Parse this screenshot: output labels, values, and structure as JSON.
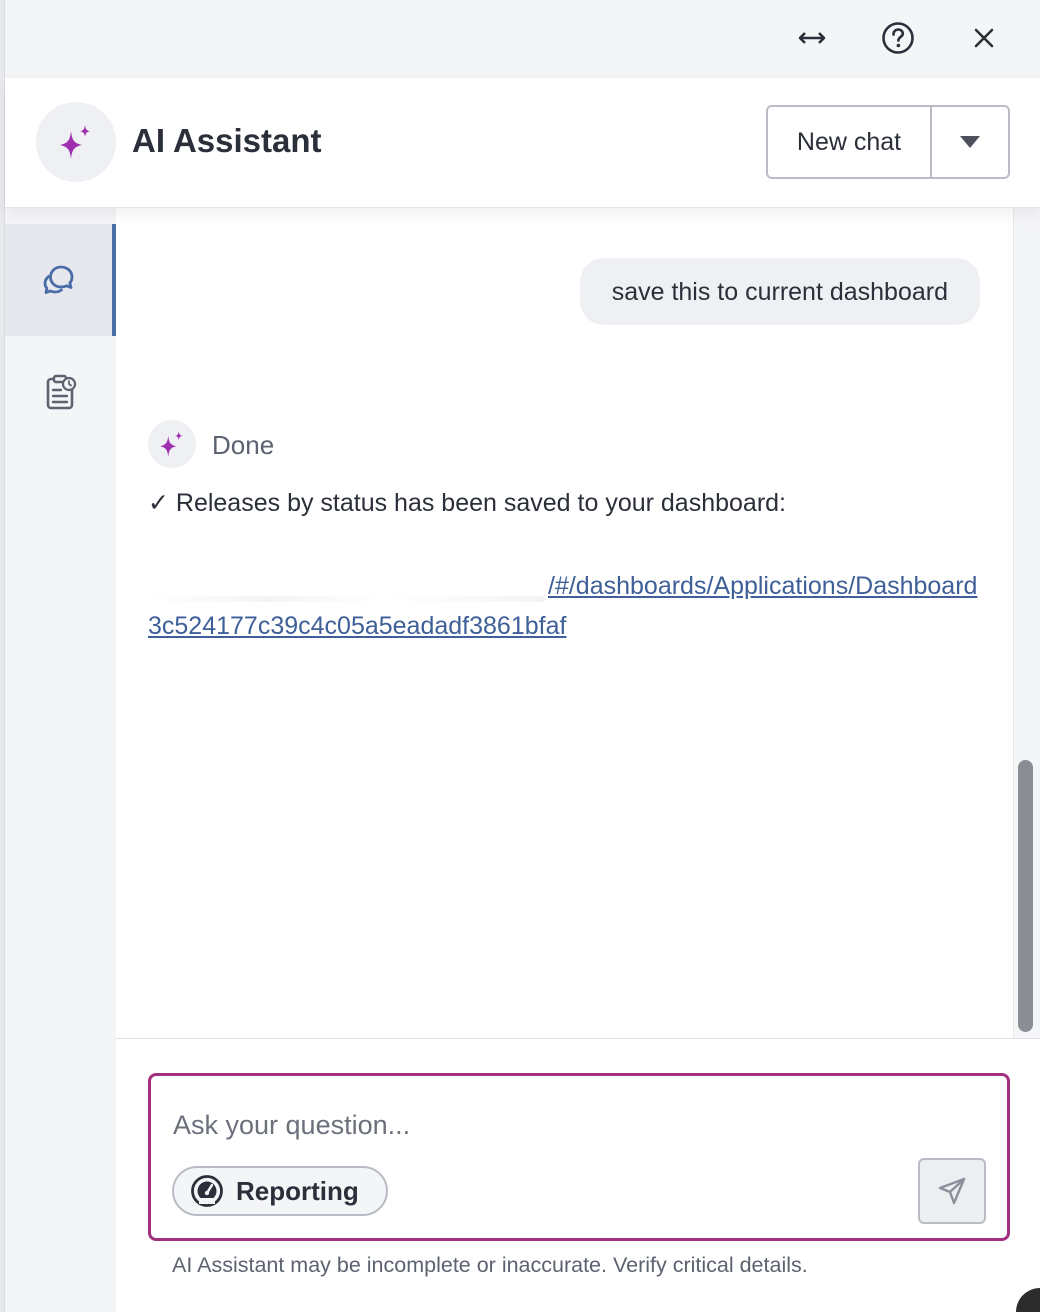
{
  "toolbar": {
    "expand_icon": "horizontal-arrows-icon",
    "help_icon": "help-circle-icon",
    "close_icon": "close-icon"
  },
  "header": {
    "title": "AI Assistant",
    "logo_icon": "sparkle-icon",
    "new_chat_label": "New chat",
    "dropdown_icon": "caret-down-icon"
  },
  "sidebar": {
    "items": [
      {
        "icon": "chat-bubbles-icon",
        "active": true
      },
      {
        "icon": "clipboard-history-icon",
        "active": false
      }
    ]
  },
  "conversation": {
    "user_message": "save this to current dashboard",
    "bot_status": "Done",
    "bot_message": "✓ Releases by status has been saved to your dashboard:",
    "bot_link": "/#/dashboards/Applications/Dashboard3c524177c39c4c05a5eadadf3861bfaf"
  },
  "composer": {
    "placeholder": "Ask your question...",
    "chip_label": "Reporting",
    "chip_icon": "gauge-icon",
    "send_icon": "send-icon",
    "disclaimer": "AI Assistant may be incomplete or inaccurate. Verify critical details."
  },
  "colors": {
    "accent": "#a3307f",
    "sparkle": "#a02fb0",
    "link": "#3e5f98",
    "active_indicator": "#4a6da7"
  }
}
